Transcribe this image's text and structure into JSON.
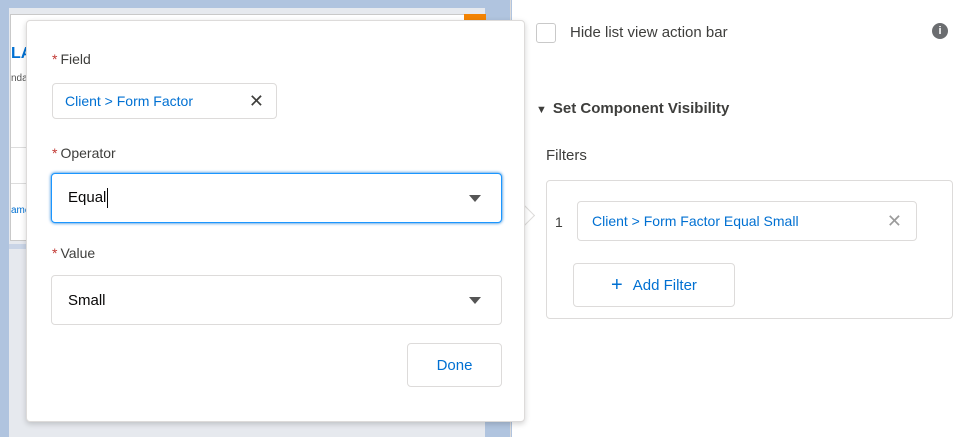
{
  "background": {
    "card_title": "LA",
    "card_sub": "nda",
    "card_frag": "ame"
  },
  "popover": {
    "field": {
      "required_mark": "*",
      "label": "Field",
      "value": "Client > Form Factor",
      "remove_icon": "close-icon"
    },
    "operator": {
      "required_mark": "*",
      "label": "Operator",
      "value": "Equal",
      "chevron_icon": "chevron-down-icon"
    },
    "value": {
      "required_mark": "*",
      "label": "Value",
      "selected": "Small",
      "chevron_icon": "chevron-down-icon"
    },
    "done_label": "Done"
  },
  "right_panel": {
    "hide_action_bar": {
      "label": "Hide list view action bar",
      "checked": false
    },
    "info_icon": "info-icon",
    "info_glyph": "i",
    "section_title": "Set Component Visibility",
    "section_expanded": true,
    "filters_label": "Filters",
    "filters": [
      {
        "index": "1",
        "text": "Client > Form Factor Equal Small"
      }
    ],
    "add_filter_label": "Add Filter"
  },
  "colors": {
    "link_blue": "#0070d2",
    "required_red": "#c23934",
    "focus_blue": "#1b96ff",
    "accent_orange": "#f38303"
  }
}
